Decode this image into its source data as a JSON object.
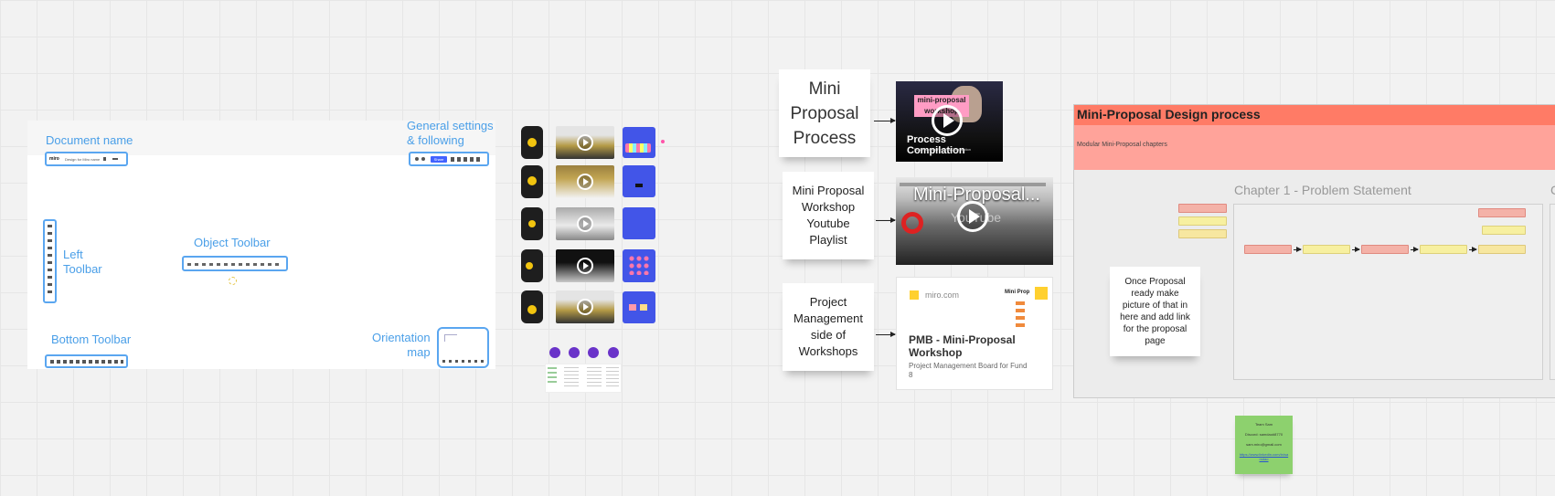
{
  "annotations": {
    "document_name": "Document name",
    "general_settings": "General settings\n& following",
    "left_toolbar": "Left\nToolbar",
    "object_toolbar": "Object Toolbar",
    "bottom_toolbar": "Bottom Toolbar",
    "orientation_map": "Orientation\nmap"
  },
  "ui_mock": {
    "logo": "miro",
    "board_name": "Design for Miro name",
    "share_label": "Share"
  },
  "stickies": {
    "mini_proposal_process": "Mini\nProposal\nProcess",
    "workshop_playlist": "Mini Proposal\nWorkshop\nYoutube\nPlaylist",
    "pm_side": "Project\nManagement\nside of\nWorkshops",
    "once_proposal": "Once Proposal\nready make\npicture of that in\nhere and add link\nfor the proposal\npage"
  },
  "video1": {
    "overlay": "mini-proposal\nworkshop",
    "caption": "Process Compilation",
    "subcaption": "Mini Proposal Process Compilation"
  },
  "video2": {
    "title": "Mini-Proposal...",
    "brand": "YouTube"
  },
  "link_card": {
    "domain": "miro.com",
    "title": "PMB - Mini-Proposal\nWorkshop",
    "description": "Project Management Board for Fund\n8",
    "thumb_label": "Mini Prop"
  },
  "design_frame": {
    "title": "Mini-Proposal Design process",
    "subtitle": "Modular Mini-Proposal chapters",
    "chapter": "Chapter 1 - Problem Statement",
    "next_chapter_initial": "C"
  },
  "green_note": {
    "line1": "Team Sam",
    "line2": "Discord: samdao#8770",
    "line3": "sam.miro@gmail.com",
    "line4": "https://www.linkedin.com/in/samdao"
  },
  "colors": {
    "accent_blue": "#5aa6f0",
    "frame_header": "#ff7b66",
    "frame_sub": "#ffa39a",
    "slide_blue": "#4255e8",
    "green_note": "#8dd16e"
  },
  "icons": [
    "play-icon",
    "miro-logo-icon",
    "youtube-icon"
  ]
}
